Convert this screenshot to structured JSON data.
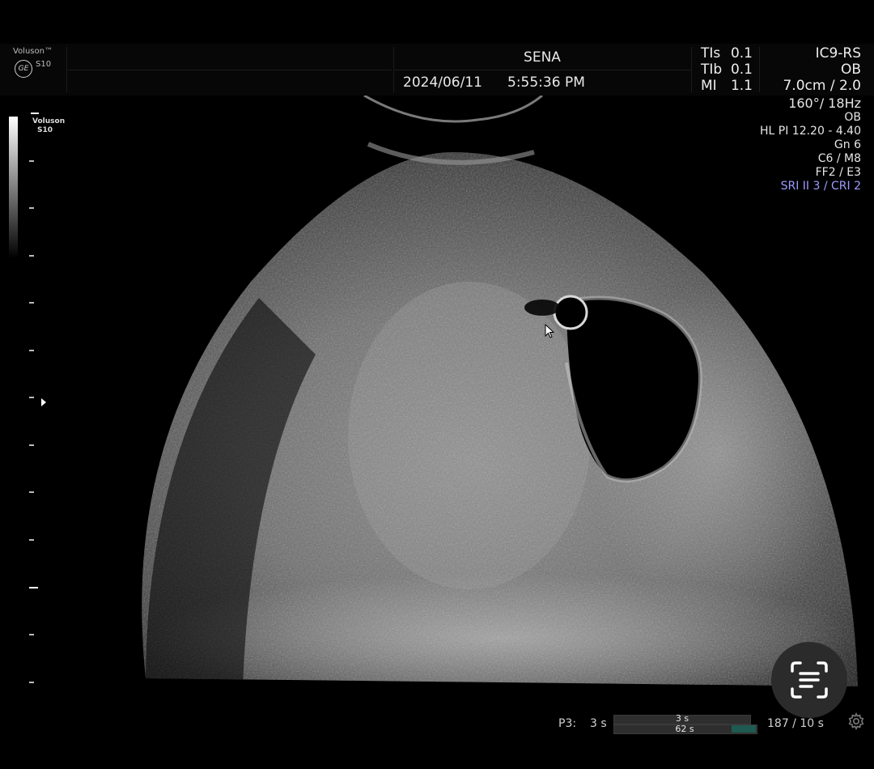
{
  "header": {
    "brand": "Voluson™",
    "ge_logo": "GE",
    "model": "S10",
    "patient_name": "SENA",
    "date": "2024/06/11",
    "time": "5:55:36 PM"
  },
  "thermal": [
    {
      "label": "TIs",
      "value": "0.1"
    },
    {
      "label": "TIb",
      "value": "0.1"
    },
    {
      "label": "MI",
      "value": "1.1"
    }
  ],
  "probe": {
    "name": "IC9-RS",
    "preset": "OB",
    "depth": "7.0cm / 2.0"
  },
  "params": {
    "angle_rate": "160°/ 18Hz",
    "mode": "OB",
    "frequency": "HL PI 12.20 - 4.40",
    "gain": "Gn   6",
    "map": "C6 / M8",
    "filter": "FF2 / E3",
    "sri": "SRI II 3 / CRI 2"
  },
  "grayscale_brand": {
    "line1": "Voluson",
    "line2": "S10"
  },
  "cine": {
    "label": "P3:",
    "time": "3 s",
    "track1_value": "3 s",
    "track2_value": "62 s",
    "frames": "187 / 10 s"
  },
  "icons": {
    "scan_button": "scan-text-icon",
    "settings": "gear-icon",
    "cursor": "arrow-cursor-icon"
  },
  "colors": {
    "background": "#000000",
    "sri_text": "#9c9cff",
    "cine_fill": "#1f5a52"
  }
}
